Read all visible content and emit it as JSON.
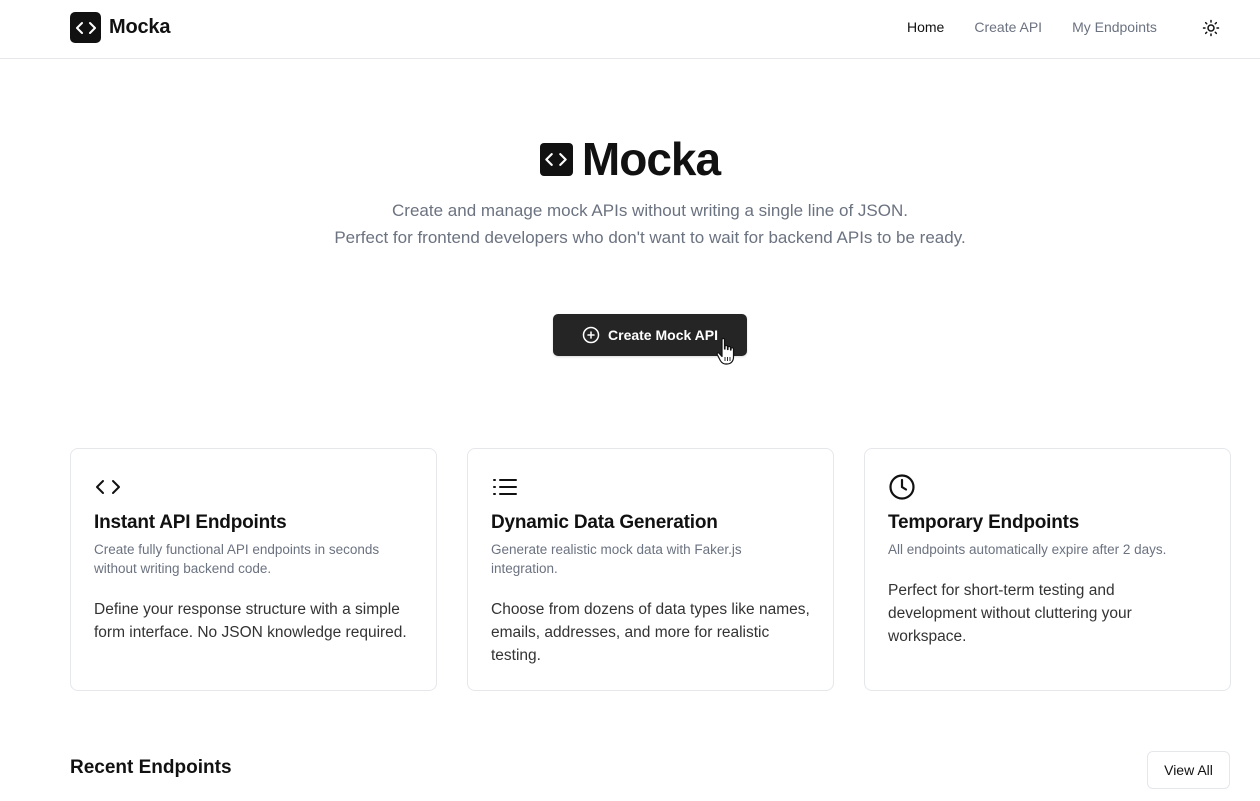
{
  "navbar": {
    "brand": "Mocka",
    "links": [
      {
        "label": "Home"
      },
      {
        "label": "Create API"
      },
      {
        "label": "My Endpoints"
      }
    ],
    "theme_icon": "sun-icon"
  },
  "hero": {
    "title": "Mocka",
    "description_line1": "Create and manage mock APIs without writing a single line of JSON.",
    "description_line2": "Perfect for frontend developers who don't want to wait for backend APIs to be ready.",
    "cta_label": "Create Mock API",
    "cta_icon": "plus-circle-icon"
  },
  "features": [
    {
      "icon": "code-icon",
      "title": "Instant API Endpoints",
      "subtitle": "Create fully functional API endpoints in seconds without writing backend code.",
      "body": "Define your response structure with a simple form interface. No JSON knowledge required."
    },
    {
      "icon": "list-icon",
      "title": "Dynamic Data Generation",
      "subtitle": "Generate realistic mock data with Faker.js integration.",
      "body": "Choose from dozens of data types like names, emails, addresses, and more for realistic testing."
    },
    {
      "icon": "clock-icon",
      "title": "Temporary Endpoints",
      "subtitle": "All endpoints automatically expire after 2 days.",
      "body": "Perfect for short-term testing and development without cluttering your workspace."
    }
  ],
  "recent": {
    "title": "Recent Endpoints",
    "view_all_label": "View All"
  }
}
